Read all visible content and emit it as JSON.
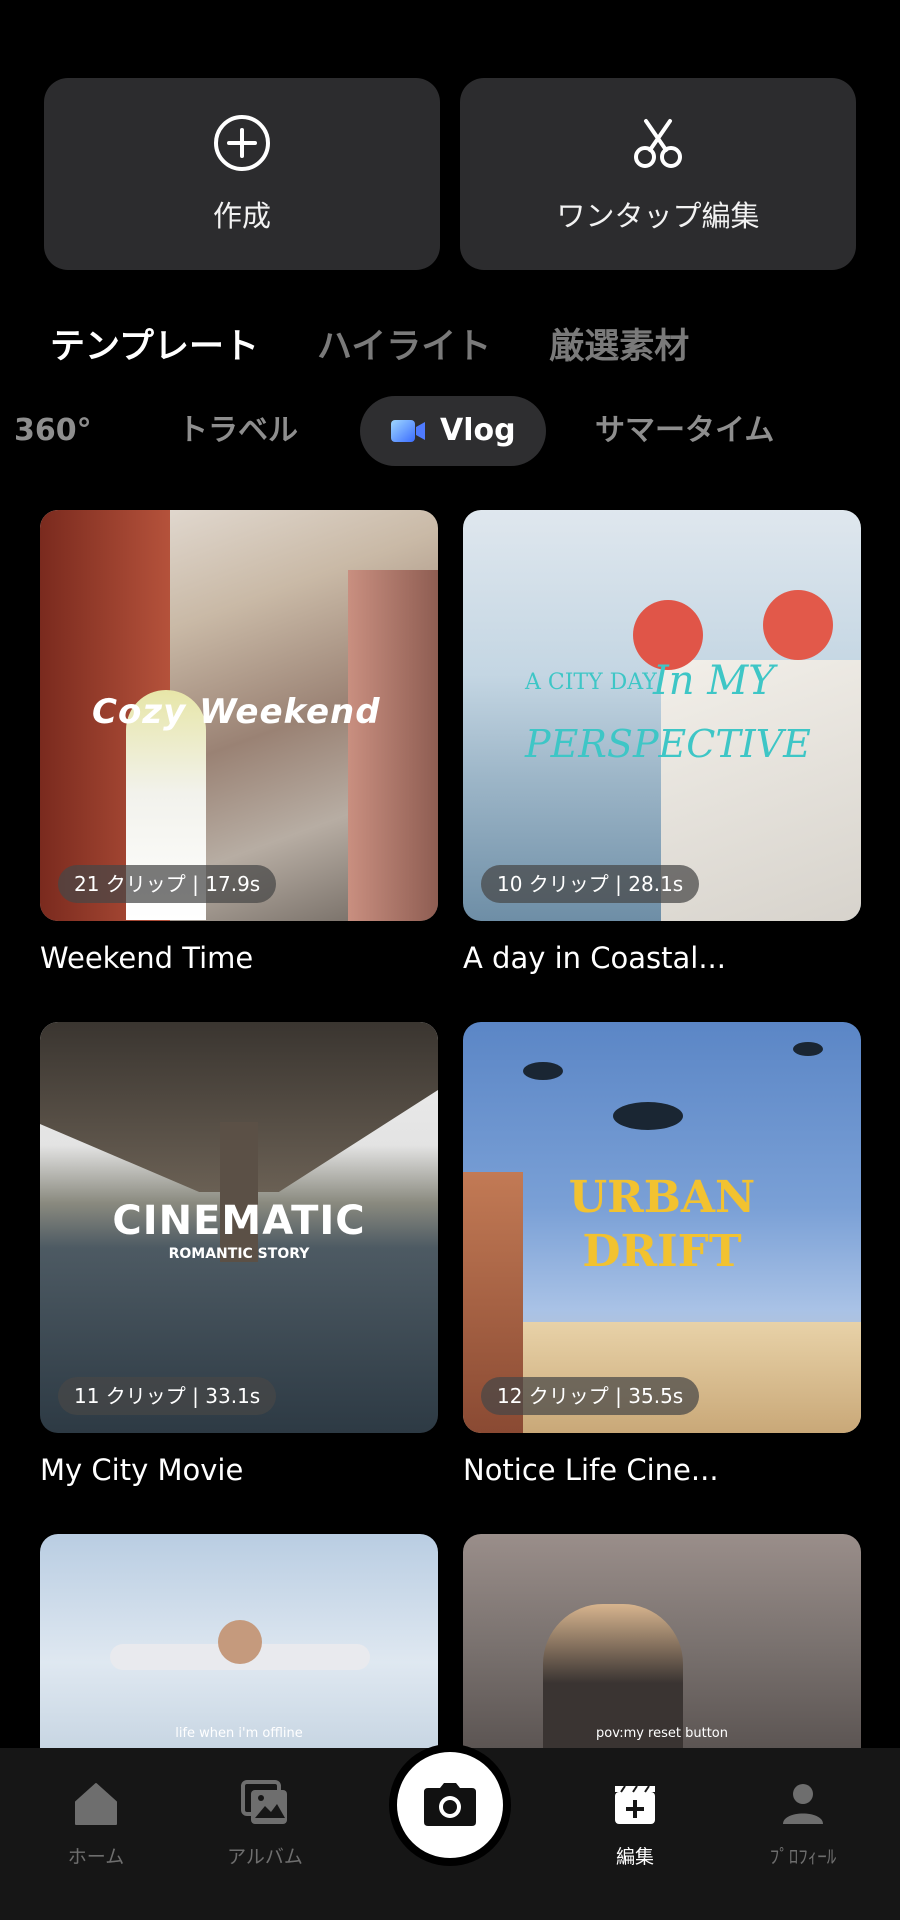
{
  "actions": {
    "create_label": "作成",
    "quick_edit_label": "ワンタップ編集"
  },
  "tabs": [
    {
      "label": "テンプレート",
      "active": true
    },
    {
      "label": "ハイライト",
      "active": false
    },
    {
      "label": "厳選素材",
      "active": false
    }
  ],
  "chips": [
    {
      "label": "360°"
    },
    {
      "label": "トラベル"
    },
    {
      "label": "Vlog",
      "active": true
    },
    {
      "label": "サマータイム"
    }
  ],
  "templates": [
    {
      "title": "Weekend Time",
      "meta": "21 クリップ | 17.9s",
      "overlay": "Cozy Weekend"
    },
    {
      "title": "A day in Coastal...",
      "meta": "10 クリップ | 28.1s",
      "overlay_top": "A CITY DAY",
      "overlay_script": "In MY",
      "overlay_bottom": "PERSPECTIVE"
    },
    {
      "title": "My City Movie",
      "meta": "11 クリップ | 33.1s",
      "overlay": "CINEMATIC",
      "overlay_sub": "ROMANTIC STORY"
    },
    {
      "title": "Notice Life Cine...",
      "meta": "12 クリップ | 35.5s",
      "overlay_line1": "URBAN",
      "overlay_line2": "DRIFT"
    },
    {
      "caption": "life when i'm offline"
    },
    {
      "caption": "pov:my reset button"
    }
  ],
  "nav": {
    "home": "ホーム",
    "album": "アルバム",
    "edit": "編集",
    "profile": "ﾌﾟﾛﾌｨｰﾙ"
  },
  "colors": {
    "background": "#000000",
    "card": "#2c2c2e",
    "inactive": "#7a7a7a",
    "urban_drift": "#f2c230",
    "coastal_text": "#3ec6c6"
  }
}
